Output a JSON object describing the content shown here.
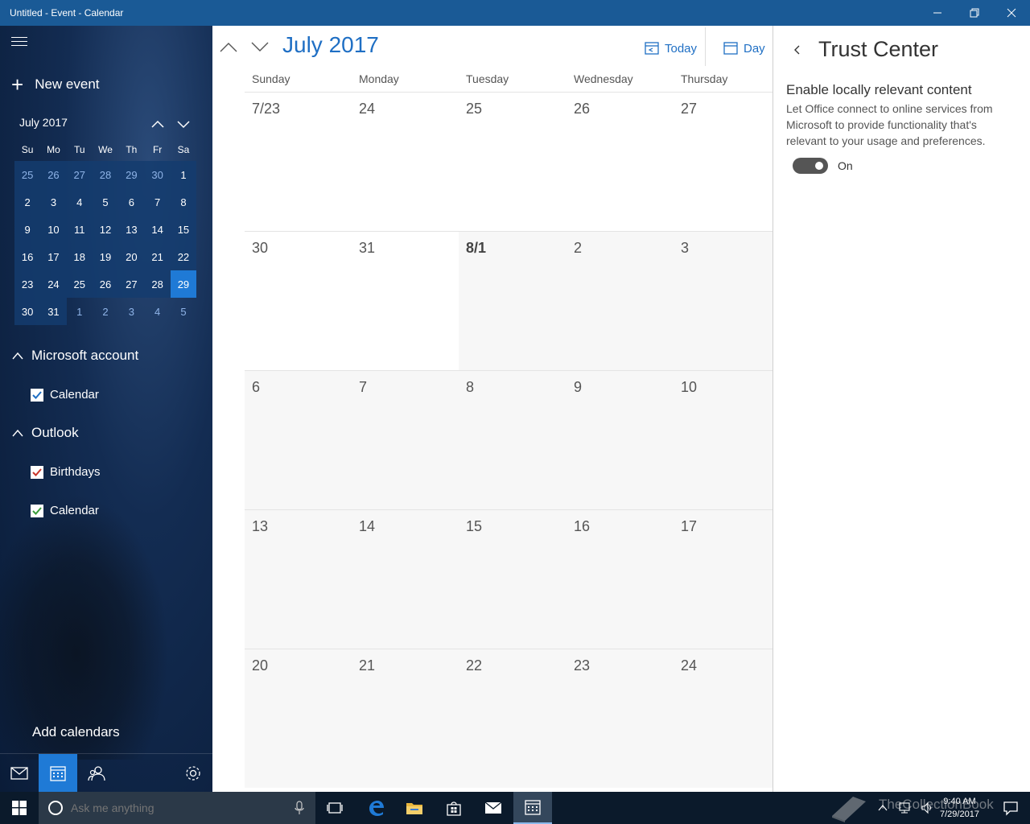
{
  "window": {
    "title": "Untitled - Event - Calendar"
  },
  "sidebar": {
    "new_event": "New event",
    "mini_month": "July 2017",
    "dow": [
      "Su",
      "Mo",
      "Tu",
      "We",
      "Th",
      "Fr",
      "Sa"
    ],
    "weeks": [
      [
        "25",
        "26",
        "27",
        "28",
        "29",
        "30",
        "1"
      ],
      [
        "2",
        "3",
        "4",
        "5",
        "6",
        "7",
        "8"
      ],
      [
        "9",
        "10",
        "11",
        "12",
        "13",
        "14",
        "15"
      ],
      [
        "16",
        "17",
        "18",
        "19",
        "20",
        "21",
        "22"
      ],
      [
        "23",
        "24",
        "25",
        "26",
        "27",
        "28",
        "29"
      ],
      [
        "30",
        "31",
        "1",
        "2",
        "3",
        "4",
        "5"
      ]
    ],
    "selected_day": "29",
    "accounts": [
      {
        "name": "Microsoft account",
        "calendars": [
          {
            "name": "Calendar",
            "color": "#1f6fc4"
          }
        ]
      },
      {
        "name": "Outlook",
        "calendars": [
          {
            "name": "Birthdays",
            "color": "#c8352a"
          },
          {
            "name": "Calendar",
            "color": "#3a9d3a"
          }
        ]
      }
    ],
    "add_calendars": "Add calendars"
  },
  "main": {
    "month_title": "July 2017",
    "today_label": "Today",
    "view_label": "Day",
    "weekdays": [
      "Sunday",
      "Monday",
      "Tuesday",
      "Wednesday",
      "Thursday"
    ],
    "weeks": [
      [
        "7/23",
        "24",
        "25",
        "26",
        "27"
      ],
      [
        "30",
        "31",
        "8/1",
        "2",
        "3"
      ],
      [
        "6",
        "7",
        "8",
        "9",
        "10"
      ],
      [
        "13",
        "14",
        "15",
        "16",
        "17"
      ],
      [
        "20",
        "21",
        "22",
        "23",
        "24"
      ]
    ]
  },
  "trust_center": {
    "title": "Trust Center",
    "option_title": "Enable locally relevant content",
    "option_description": "Let Office connect to online services from Microsoft to provide functionality that's relevant to your usage and preferences.",
    "toggle_state": "On"
  },
  "taskbar": {
    "search_placeholder": "Ask me anything",
    "time": "9:40 AM",
    "date": "7/29/2017",
    "watermark": "TheCollectionBook"
  },
  "colors": {
    "accent": "#1f6fc4",
    "titlebar": "#1a5a96",
    "selected": "#1f7ad6"
  }
}
